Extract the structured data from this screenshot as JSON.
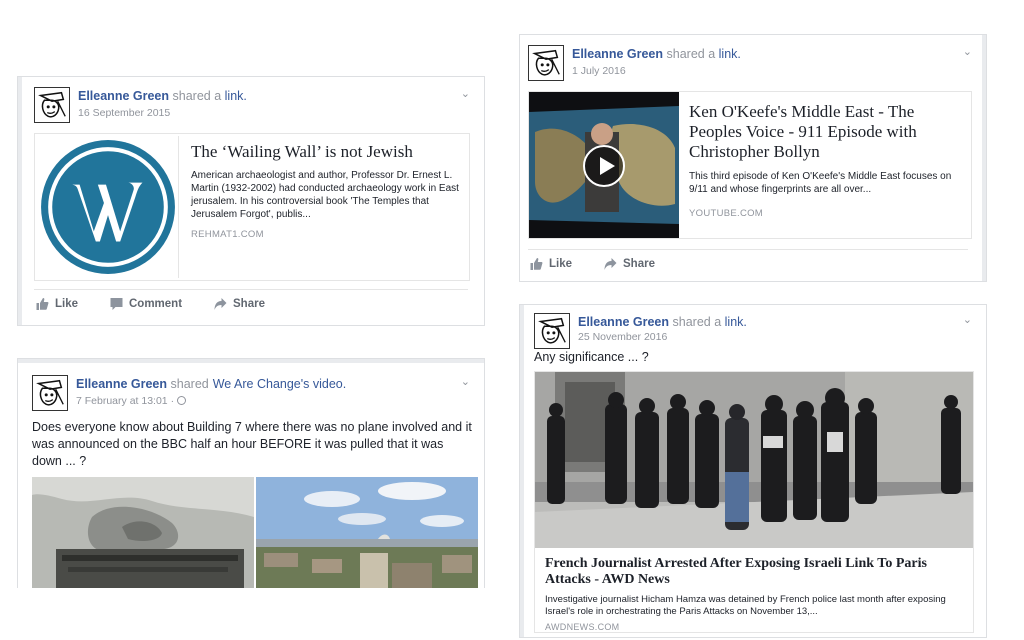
{
  "author": "Elleanne Green",
  "posts": {
    "wp": {
      "verb": "shared a",
      "object": "link.",
      "date": "16 September 2015",
      "link_title": "The ‘Wailing Wall’ is not Jewish",
      "link_desc": "American archaeologist and author, Professor Dr. Ernest L. Martin (1932-2002) had conducted archaeology work in East jerusalem. In his controversial book 'The Temples that Jerusalem Forgot', publis...",
      "link_domain": "REHMAT1.COM",
      "actions": {
        "like": "Like",
        "comment": "Comment",
        "share": "Share"
      }
    },
    "kok": {
      "verb": "shared a",
      "object": "link.",
      "date": "1 July 2016",
      "link_title": "Ken O'Keefe's Middle East - The Peoples Voice - 911 Episode with Christopher Bollyn",
      "link_desc": "This third episode of Ken O'Keefe's Middle East focuses on 9/11 and whose fingerprints are all over...",
      "link_domain": "YOUTUBE.COM",
      "actions": {
        "like": "Like",
        "share": "Share"
      }
    },
    "wac": {
      "verb": "shared",
      "page": "We Are Change",
      "object": "'s video.",
      "date": "7 February at 13:01",
      "date_sep": "·",
      "message": "Does everyone know about Building 7 where there was no plane involved and it was announced on the BBC half an hour BEFORE it was pulled that it was down ... ?"
    },
    "fj": {
      "verb": "shared a",
      "object": "link.",
      "date": "25 November 2016",
      "message": "Any significance ... ?",
      "link_title": "French Journalist Arrested After Exposing Israeli Link To Paris Attacks - AWD News",
      "link_desc": "Investigative journalist Hicham Hamza was detained by French police last month after exposing Israel's role in orchestrating the Paris Attacks on November 13,...",
      "link_domain": "AWDNEWS.COM"
    }
  },
  "colors": {
    "link_blue": "#365899",
    "grey_text": "#90949c",
    "border": "#dddfe2",
    "wp_blue": "#21759b"
  },
  "icons": [
    "chevron-down-icon",
    "globe-icon",
    "thumbs-up-icon",
    "comment-icon",
    "share-icon",
    "play-icon",
    "wordpress-logo"
  ]
}
